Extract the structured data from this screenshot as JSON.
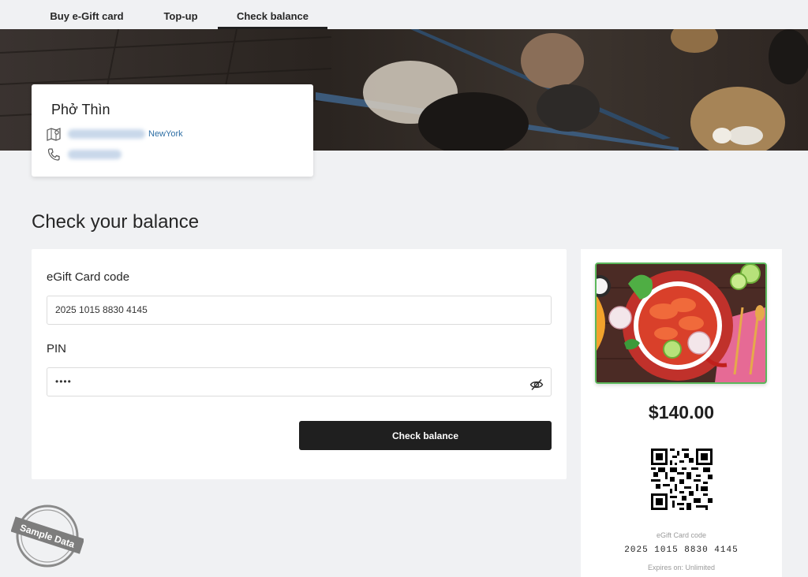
{
  "tabs": [
    {
      "label": "Buy e-Gift card",
      "active": false
    },
    {
      "label": "Top-up",
      "active": false
    },
    {
      "label": "Check balance",
      "active": true
    }
  ],
  "restaurant": {
    "name": "Phở Thìn",
    "city": "NewYork",
    "address_icon": "map-pin-icon",
    "phone_icon": "phone-icon"
  },
  "page": {
    "title": "Check your balance"
  },
  "form": {
    "code_label": "eGift Card code",
    "code_value": "2025 1015 8830 4145",
    "pin_label": "PIN",
    "pin_value": "••••",
    "pin_toggle_icon": "eye-off-icon",
    "submit_label": "Check balance"
  },
  "gift_card": {
    "amount": "$140.00",
    "code_label": "eGift Card code",
    "code_value": "2025 1015 8830 4145",
    "expires": "Expires on: Unlimited"
  },
  "stamp": {
    "text": "Sample Data"
  },
  "colors": {
    "button_bg": "#1f1f1f",
    "link": "#2f6fa5",
    "card_border": "#5cb85c",
    "page_bg": "#f0f1f3"
  }
}
